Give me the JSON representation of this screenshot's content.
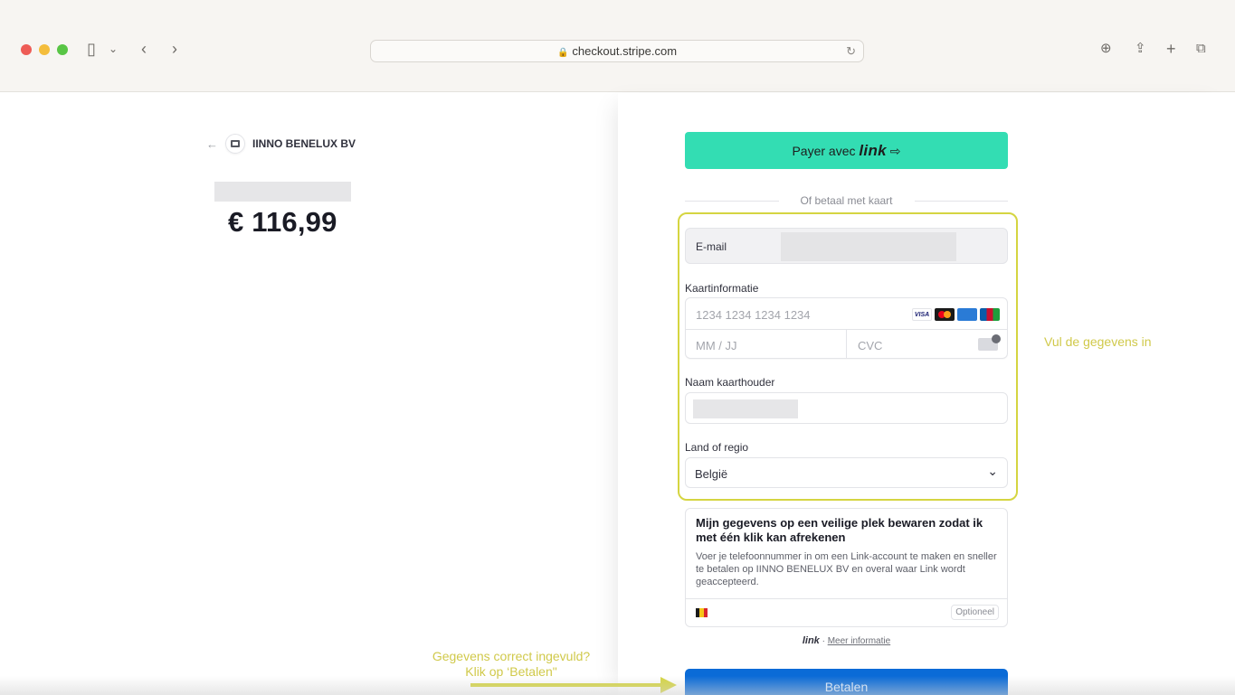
{
  "browser": {
    "url": "checkout.stripe.com"
  },
  "merchant": {
    "name": "IINNO BENELUX BV",
    "amount": "€ 116,99"
  },
  "link_button": {
    "prefix": "Payer avec",
    "brand": "link",
    "arrow": "⇨"
  },
  "divider_text": "Of betaal met kaart",
  "form": {
    "email_label": "E-mail",
    "card_label": "Kaartinformatie",
    "card_number_placeholder": "1234 1234 1234 1234",
    "expiry_placeholder": "MM / JJ",
    "cvc_placeholder": "CVC",
    "card_brands": [
      "VISA",
      "Mastercard",
      "AMEX",
      "JCB"
    ],
    "cardholder_label": "Naam kaarthouder",
    "country_label": "Land of regio",
    "country_value": "België"
  },
  "save_box": {
    "title": "Mijn gegevens op een veilige plek bewaren zodat ik met één klik kan afrekenen",
    "description": "Voer je telefoonnummer in om een Link-account te maken en sneller te betalen op IINNO BENELUX BV en overal waar Link wordt geaccepteerd.",
    "optional": "Optioneel"
  },
  "link_footer": {
    "brand": "link",
    "separator": "·",
    "more": "Meer informatie"
  },
  "pay_button": "Betalen",
  "annotations": {
    "right": "Vul de gegevens in",
    "left_line1": "Gegevens correct ingevuld?",
    "left_line2": "Klik op ‘Betalen\""
  },
  "colors": {
    "link_green": "#33ddb3",
    "pay_blue": "#0a6bd7",
    "annotation_yellow": "#d5d541"
  }
}
